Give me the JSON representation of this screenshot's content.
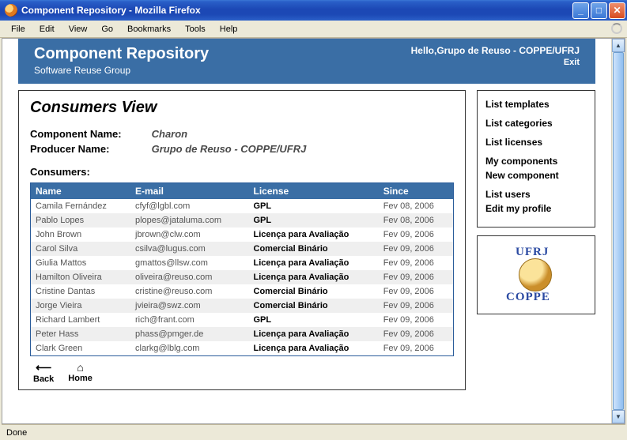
{
  "window": {
    "title": "Component Repository - Mozilla Firefox",
    "status": "Done"
  },
  "menu": {
    "file": "File",
    "edit": "Edit",
    "view": "View",
    "go": "Go",
    "bookmarks": "Bookmarks",
    "tools": "Tools",
    "help": "Help"
  },
  "header": {
    "title": "Component Repository",
    "subtitle": "Software Reuse Group",
    "greeting": "Hello,Grupo de Reuso - COPPE/UFRJ",
    "exit": "Exit"
  },
  "sidebar": {
    "links": {
      "list_templates": "List templates",
      "list_categories": "List categories",
      "list_licenses": "List licenses",
      "my_components": "My components",
      "new_component": "New component",
      "list_users": "List users",
      "edit_profile": "Edit my profile"
    },
    "logo_top": "UFRJ",
    "logo_bottom": "COPPE"
  },
  "main": {
    "heading": "Consumers View",
    "component_label": "Component Name:",
    "component_value": "Charon",
    "producer_label": "Producer Name:",
    "producer_value": "Grupo de Reuso - COPPE/UFRJ",
    "consumers_label": "Consumers:",
    "table": {
      "headers": {
        "name": "Name",
        "email": "E-mail",
        "license": "License",
        "since": "Since"
      },
      "rows": [
        {
          "name": "Camila Fernández",
          "email": "cfyf@lgbl.com",
          "license": "GPL",
          "since": "Fev 08, 2006"
        },
        {
          "name": "Pablo Lopes",
          "email": "plopes@jataluma.com",
          "license": "GPL",
          "since": "Fev 08, 2006"
        },
        {
          "name": "John Brown",
          "email": "jbrown@clw.com",
          "license": "Licença para Avaliação",
          "since": "Fev 09, 2006"
        },
        {
          "name": "Carol Silva",
          "email": "csilva@lugus.com",
          "license": "Comercial Binário",
          "since": "Fev 09, 2006"
        },
        {
          "name": "Giulia Mattos",
          "email": "gmattos@llsw.com",
          "license": "Licença para Avaliação",
          "since": "Fev 09, 2006"
        },
        {
          "name": "Hamilton Oliveira",
          "email": "oliveira@reuso.com",
          "license": "Licença para Avaliação",
          "since": "Fev 09, 2006"
        },
        {
          "name": "Cristine Dantas",
          "email": "cristine@reuso.com",
          "license": "Comercial Binário",
          "since": "Fev 09, 2006"
        },
        {
          "name": "Jorge Vieira",
          "email": "jvieira@swz.com",
          "license": "Comercial Binário",
          "since": "Fev 09, 2006"
        },
        {
          "name": "Richard Lambert",
          "email": "rich@frant.com",
          "license": "GPL",
          "since": "Fev 09, 2006"
        },
        {
          "name": "Peter Hass",
          "email": "phass@pmger.de",
          "license": "Licença para Avaliação",
          "since": "Fev 09, 2006"
        },
        {
          "name": "Clark Green",
          "email": "clarkg@lblg.com",
          "license": "Licença para Avaliação",
          "since": "Fev 09, 2006"
        }
      ]
    },
    "nav": {
      "back": "Back",
      "home": "Home"
    }
  }
}
